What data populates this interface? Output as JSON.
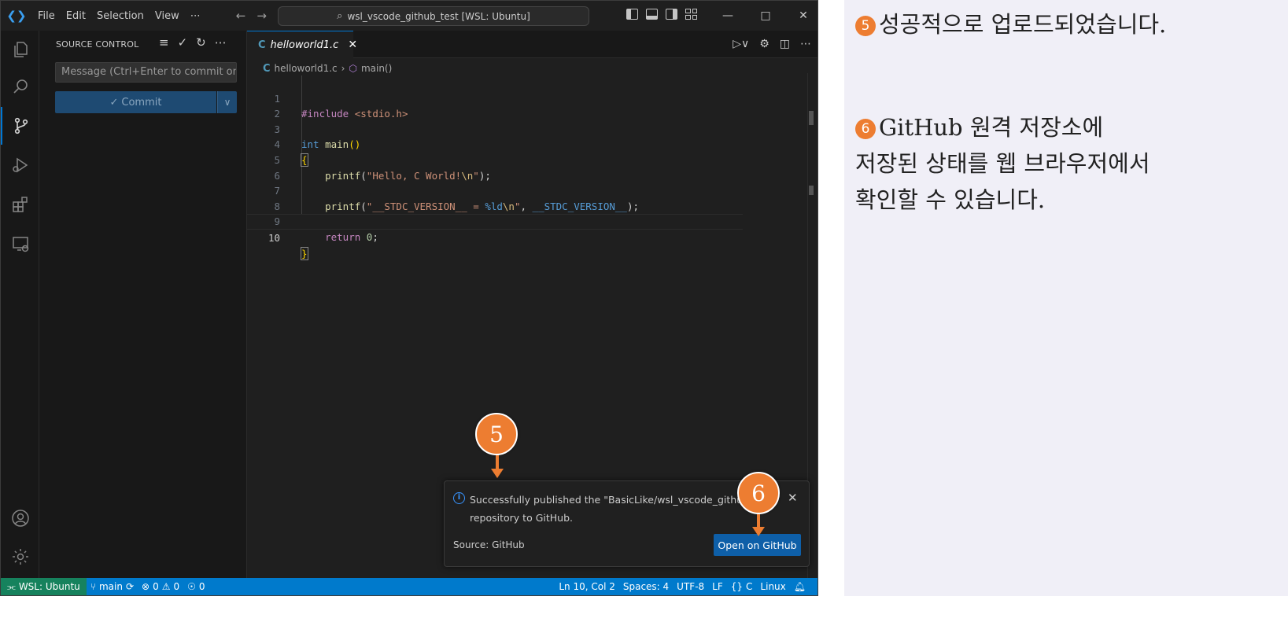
{
  "window": {
    "menu": [
      "File",
      "Edit",
      "Selection",
      "View",
      "⋯"
    ],
    "search_text": "wsl_vscode_github_test [WSL: Ubuntu]"
  },
  "sidebar": {
    "title": "SOURCE CONTROL",
    "commit_placeholder": "Message (Ctrl+Enter to commit on...",
    "commit_label": "Commit"
  },
  "editor": {
    "tab_label": "helloworld1.c",
    "breadcrumb": {
      "file": "helloworld1.c",
      "symbol": "main()"
    },
    "lines": [
      {
        "n": "1",
        "text": "#include <stdio.h>"
      },
      {
        "n": "2",
        "text": ""
      },
      {
        "n": "3",
        "text": "int main()"
      },
      {
        "n": "4",
        "text": "{"
      },
      {
        "n": "5",
        "text": "    printf(\"Hello, C World!\\n\");"
      },
      {
        "n": "6",
        "text": ""
      },
      {
        "n": "7",
        "text": "    printf(\"__STDC_VERSION__ = %ld\\n\", __STDC_VERSION__);"
      },
      {
        "n": "8",
        "text": ""
      },
      {
        "n": "9",
        "text": "    return 0;"
      },
      {
        "n": "10",
        "text": "}"
      }
    ]
  },
  "notification": {
    "message": "Successfully published the \"BasicLike/wsl_vscode_github_t...",
    "message_line2": "repository to GitHub.",
    "source": "Source: GitHub",
    "button": "Open on GitHub"
  },
  "statusbar": {
    "remote": "WSL: Ubuntu",
    "branch": "main",
    "errors": "0",
    "warnings": "0",
    "ports": "0",
    "position": "Ln 10, Col 2",
    "spaces": "Spaces: 4",
    "encoding": "UTF-8",
    "eol": "LF",
    "language": "C",
    "platform": "Linux"
  },
  "markers": {
    "m5": "5",
    "m6": "6"
  },
  "annotations": {
    "note5_num": "5",
    "note5": "성공적으로 업로드되었습니다.",
    "note6_num": "6",
    "note6_line1": "GitHub 원격 저장소에",
    "note6_line2": "저장된 상태를 웹 브라우저에서",
    "note6_line3": "확인할 수 있습니다."
  },
  "colors": {
    "accent": "#007acc",
    "remote": "#16825d",
    "marker": "#ed7d31",
    "panel_bg": "#f0eff7"
  }
}
